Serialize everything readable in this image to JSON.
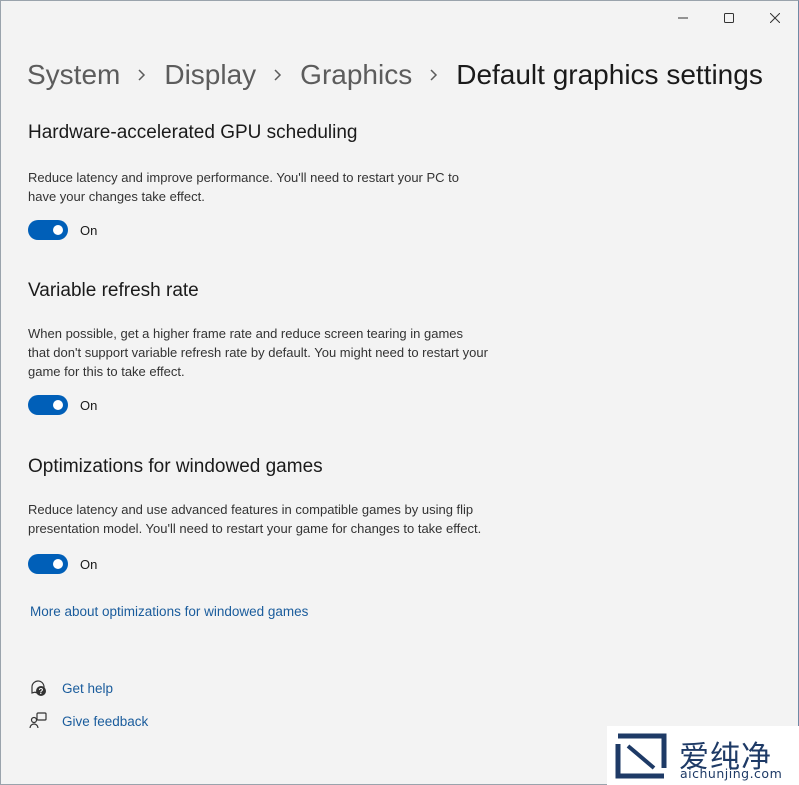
{
  "window": {
    "controls": {
      "minimize_icon": "minimize-icon",
      "maximize_icon": "maximize-icon",
      "close_icon": "close-icon"
    }
  },
  "breadcrumb": {
    "items": [
      "System",
      "Display",
      "Graphics"
    ],
    "current": "Default graphics settings"
  },
  "sections": [
    {
      "title": "Hardware-accelerated GPU scheduling",
      "description": "Reduce latency and improve performance. You'll need to restart your PC to have your changes take effect.",
      "toggle_state": "On"
    },
    {
      "title": "Variable refresh rate",
      "description": "When possible, get a higher frame rate and reduce screen tearing in games that don't support variable refresh rate by default. You might need to restart your game for this to take effect.",
      "toggle_state": "On"
    },
    {
      "title": "Optimizations for windowed games",
      "description": "Reduce latency and use advanced features in compatible games by using flip presentation model. You'll need to restart your game for changes to take effect.",
      "toggle_state": "On"
    }
  ],
  "more_link": "More about optimizations for windowed games",
  "help": {
    "get_help": "Get help",
    "give_feedback": "Give feedback"
  },
  "watermark": {
    "chinese": "爱纯净",
    "domain": "aichunjing.com"
  },
  "colors": {
    "accent": "#005fb8",
    "link": "#1a5c9c",
    "background": "#f3f3f3"
  }
}
